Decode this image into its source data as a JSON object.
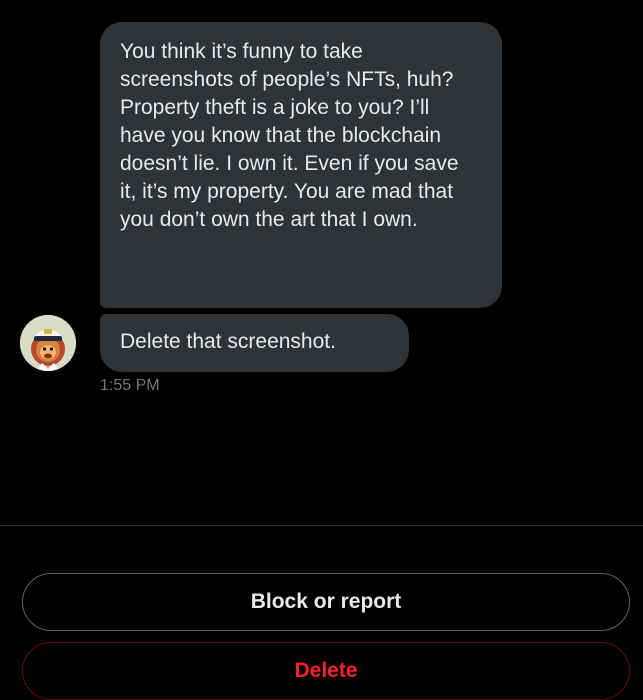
{
  "conversation": {
    "messages": [
      {
        "sender": "other",
        "text": "You think it’s funny to take screenshots of people’s NFTs, huh? Property theft is a joke to you? I’ll have you know that the blockchain doesn’t lie. I own it. Even if you save it, it’s my property. You are mad that you don’t own the art that I own."
      },
      {
        "sender": "other",
        "text": "Delete that screenshot."
      }
    ],
    "timestamp": "1:55 PM",
    "avatar_icon": "nft-lion-avatar-icon"
  },
  "actions": {
    "block_report_label": "Block or report",
    "delete_label": "Delete"
  },
  "colors": {
    "background": "#000000",
    "bubble": "#2f3336",
    "text": "#e7e9ea",
    "muted_text": "#71767b",
    "danger": "#f4212e",
    "danger_border": "#67070f",
    "button_border": "#536471"
  }
}
